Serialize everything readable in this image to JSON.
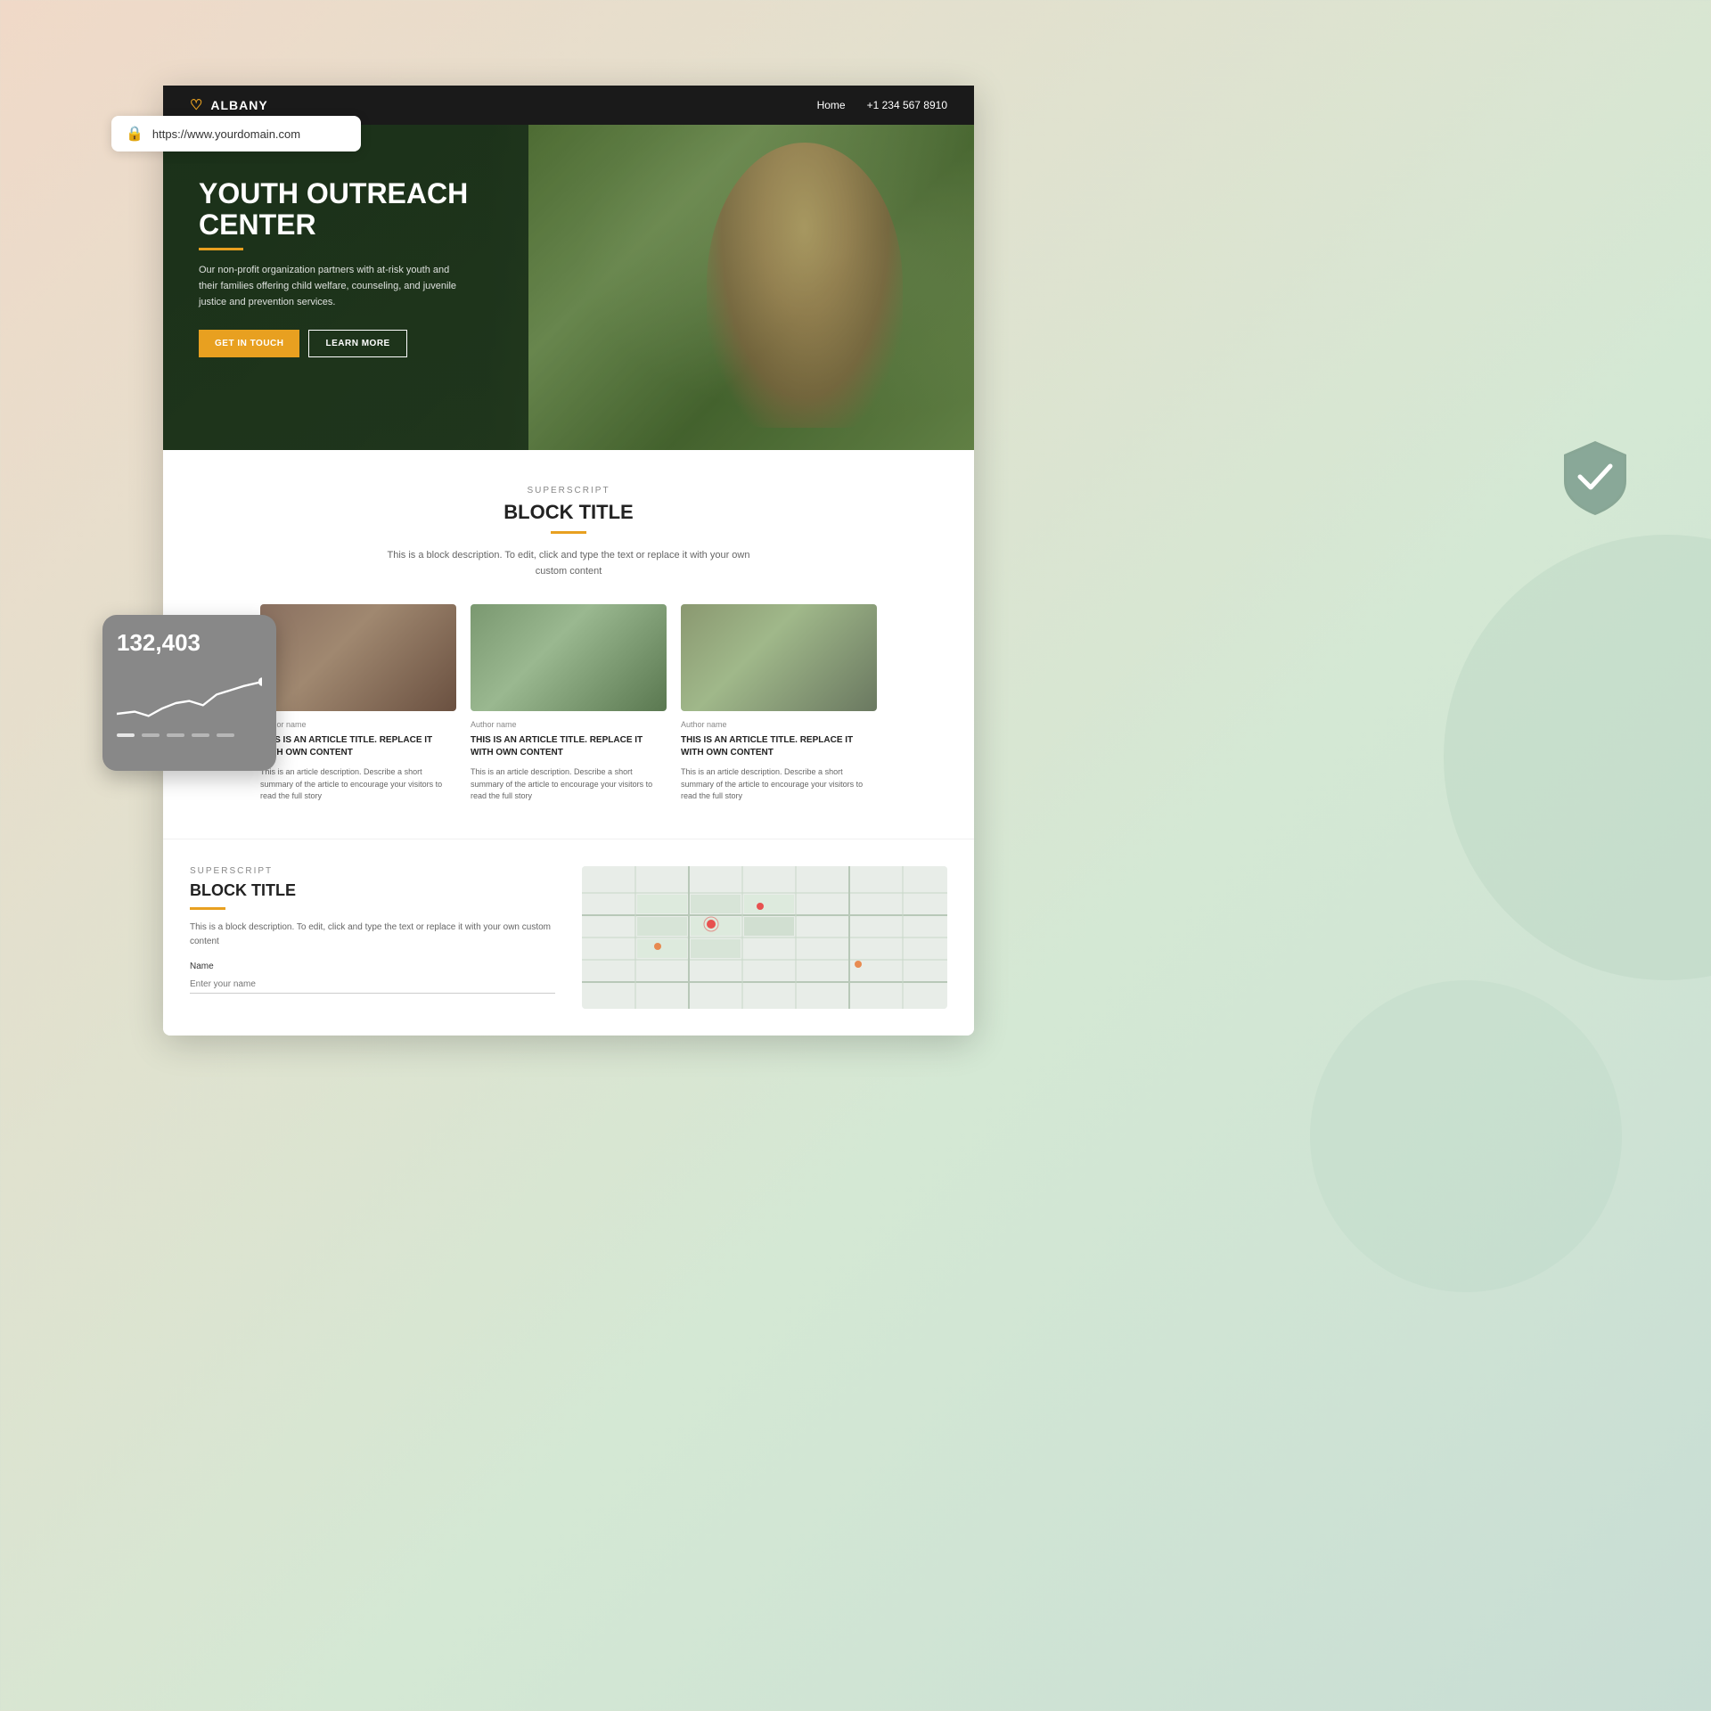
{
  "background": {
    "gradient": "peach-to-sage"
  },
  "address_bar": {
    "url": "https://www.yourdomain.com",
    "lock_icon": "🔒"
  },
  "nav": {
    "logo": "ALBANY",
    "logo_icon": "♡",
    "links": [
      "Home",
      "+1 234 567 8910"
    ]
  },
  "hero": {
    "title_line1": "YOUTH OUTREACH",
    "title_line2": "CENTER",
    "description": "Our non-profit organization partners with at-risk youth and their families offering child welfare, counseling, and juvenile justice and prevention services.",
    "btn_primary": "GET IN TOUCH",
    "btn_secondary": "LEARN MORE"
  },
  "section1": {
    "superscript": "SUPERSCRIPT",
    "title": "BLOCK TITLE",
    "description": "This is a block description. To edit, click and type the text or replace it with your own custom content",
    "articles": [
      {
        "author": "Author name",
        "title": "THIS IS AN ARTICLE TITLE. REPLACE IT WITH OWN CONTENT",
        "description": "This is an article description. Describe a short summary of the article to encourage your visitors to read the full story"
      },
      {
        "author": "Author name",
        "title": "THIS IS AN ARTICLE TITLE. REPLACE IT WITH OWN CONTENT",
        "description": "This is an article description. Describe a short summary of the article to encourage your visitors to read the full story"
      },
      {
        "author": "Author name",
        "title": "THIS IS AN ARTICLE TITLE. REPLACE IT WITH OWN CONTENT",
        "description": "This is an article description. Describe a short summary of the article to encourage your visitors to read the full story"
      }
    ]
  },
  "section2": {
    "superscript": "SUPERSCRIPT",
    "title": "BLOCK TITLE",
    "description": "This is a block description. To edit, click and type the text or replace it with your own custom content",
    "form": {
      "name_label": "Name",
      "name_placeholder": "Enter your name"
    }
  },
  "stats_widget": {
    "number": "132,403"
  },
  "get_in_touch": "GET IN ToucH"
}
